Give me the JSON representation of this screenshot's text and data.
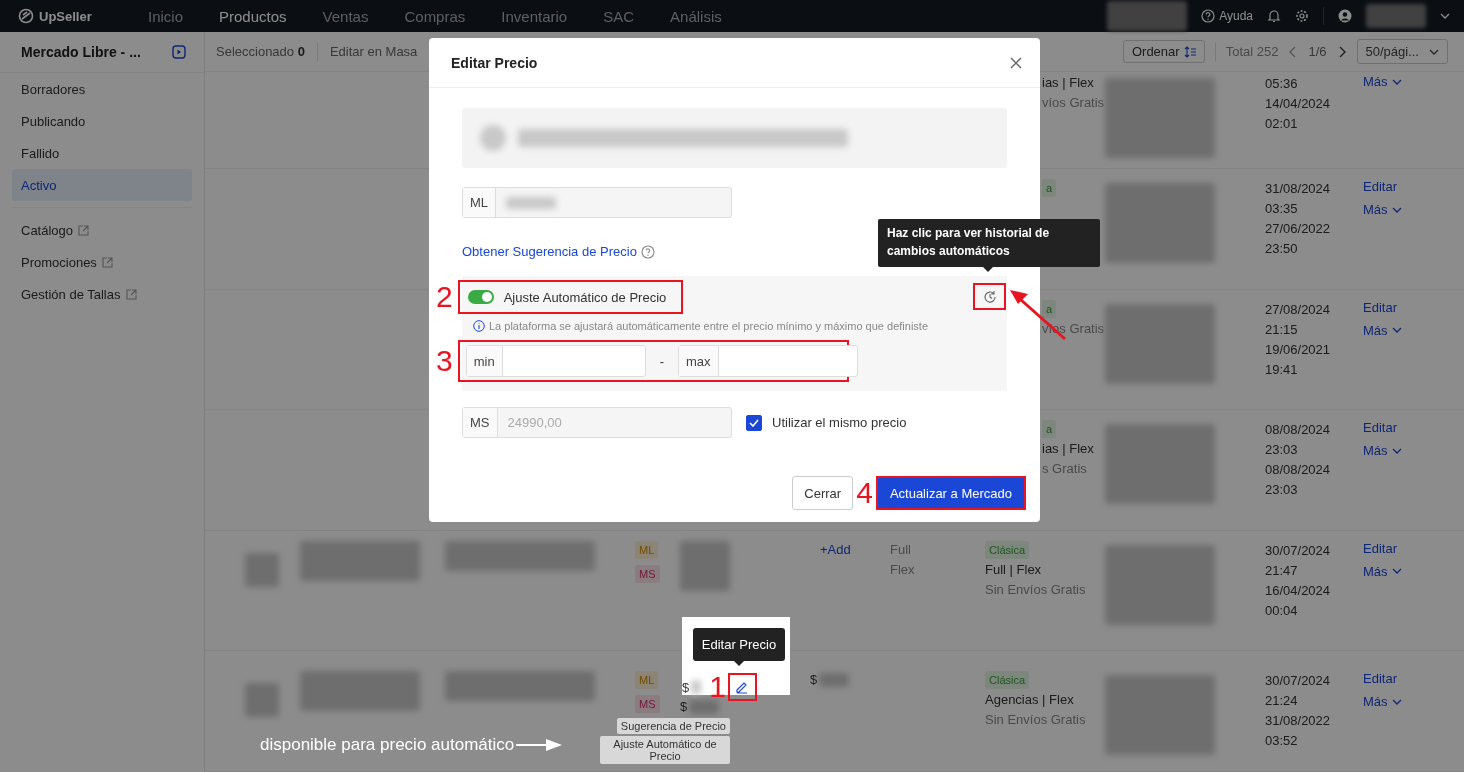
{
  "top_bar": {
    "logo": "UpSeller",
    "nav": [
      {
        "label": "Inicio",
        "selected": false
      },
      {
        "label": "Productos",
        "selected": true
      },
      {
        "label": "Ventas",
        "selected": false
      },
      {
        "label": "Compras",
        "selected": false
      },
      {
        "label": "Inventario",
        "selected": false
      },
      {
        "label": "SAC",
        "selected": false
      },
      {
        "label": "Análisis",
        "selected": false
      }
    ],
    "help": "Ayuda"
  },
  "sidebar": {
    "title": "Mercado Libre - ...",
    "items": [
      {
        "label": "Borradores",
        "selected": false,
        "external": false
      },
      {
        "label": "Publicando",
        "selected": false,
        "external": false
      },
      {
        "label": "Fallido",
        "selected": false,
        "external": false
      },
      {
        "label": "Activo",
        "selected": true,
        "external": false
      },
      {
        "label": "Catálogo",
        "selected": false,
        "external": true
      },
      {
        "label": "Promociones",
        "selected": false,
        "external": true
      },
      {
        "label": "Gestión de Tallas",
        "selected": false,
        "external": true
      }
    ]
  },
  "toolbar": {
    "selected_label": "Seleccionado",
    "selected_count": "0",
    "bulk_edit": "Editar en Masa",
    "sort": "Ordenar",
    "total": "Total 252",
    "page": "1/6",
    "page_size": "50/pági..."
  },
  "rows": [
    {
      "kind": "covered",
      "logistics": [
        "ias | Flex",
        "víos Gratis"
      ],
      "dates": [
        "05:36",
        "14/04/2024",
        "02:01"
      ],
      "actions": [
        {
          "label": "Más",
          "kind": "menu"
        }
      ]
    },
    {
      "kind": "covered",
      "badge": "a",
      "dates": [
        "31/08/2024",
        "03:35",
        "27/06/2022",
        "23:50"
      ],
      "actions": [
        {
          "label": "Editar",
          "kind": "link"
        },
        {
          "label": "Más",
          "kind": "menu"
        }
      ]
    },
    {
      "kind": "covered",
      "badge": "a",
      "logistics": [
        "víos Gratis"
      ],
      "dates": [
        "27/08/2024",
        "21:15",
        "19/06/2021",
        "19:41"
      ],
      "actions": [
        {
          "label": "Editar",
          "kind": "link"
        },
        {
          "label": "Más",
          "kind": "menu"
        }
      ]
    },
    {
      "kind": "covered",
      "badge": "a",
      "logistics": [
        "ias | Flex",
        "s Gratis"
      ],
      "dates": [
        "08/08/2024",
        "23:03",
        "08/08/2024",
        "23:03"
      ],
      "actions": [
        {
          "label": "Editar",
          "kind": "link"
        },
        {
          "label": "Más",
          "kind": "menu"
        }
      ]
    },
    {
      "kind": "full",
      "tags": [
        "ML",
        "MS"
      ],
      "add": "+Add",
      "shipping": [
        "Full",
        "Flex"
      ],
      "badge": "Clásica",
      "logistics": [
        "Full | Flex",
        "Sin Envíos Gratis"
      ],
      "dates": [
        "30/07/2024",
        "21:47",
        "16/04/2024",
        "00:04"
      ],
      "actions": [
        {
          "label": "Editar",
          "kind": "link"
        },
        {
          "label": "Más",
          "kind": "menu"
        }
      ]
    },
    {
      "kind": "full",
      "tags": [
        "ML",
        "MS"
      ],
      "price": "$",
      "cost": "$",
      "badge": "Clásica",
      "logistics": [
        "Agencias | Flex",
        "Sin Envíos Gratis"
      ],
      "dates": [
        "30/07/2024",
        "21:24",
        "31/08/2022",
        "03:52"
      ],
      "actions": [
        {
          "label": "Editar",
          "kind": "link"
        },
        {
          "label": "Más",
          "kind": "menu"
        }
      ],
      "price_tags": [
        "Sugerencia de Precio",
        "Ajuste Automático de Precio"
      ]
    }
  ],
  "modal": {
    "title": "Editar Precio",
    "listing_field": {
      "prefix": "ML"
    },
    "suggest_link": "Obtener Sugerencia de Precio",
    "auto_adjust": {
      "label": "Ajuste Automático de Precio",
      "on": true,
      "hint": "La plataforma se ajustará automáticamente entre el precio mínimo y máximo que definiste",
      "min_label": "min",
      "max_label": "max",
      "separator": "-"
    },
    "history_tooltip": "Haz clic para ver historial de cambios automáticos",
    "ms_field": {
      "prefix": "MS",
      "value": "24990,00",
      "disabled": true
    },
    "same_price": {
      "label": "Utilizar el mismo precio",
      "checked": true
    },
    "buttons": [
      {
        "label": "Cerrar",
        "kind": "secondary"
      },
      {
        "label": "Actualizar a Mercado",
        "kind": "primary"
      }
    ]
  },
  "annotations": {
    "steps": [
      "1",
      "2",
      "3",
      "4"
    ],
    "edit_tooltip": "Editar Precio",
    "spot_price": "$",
    "callout": "disponible para precio automático"
  }
}
